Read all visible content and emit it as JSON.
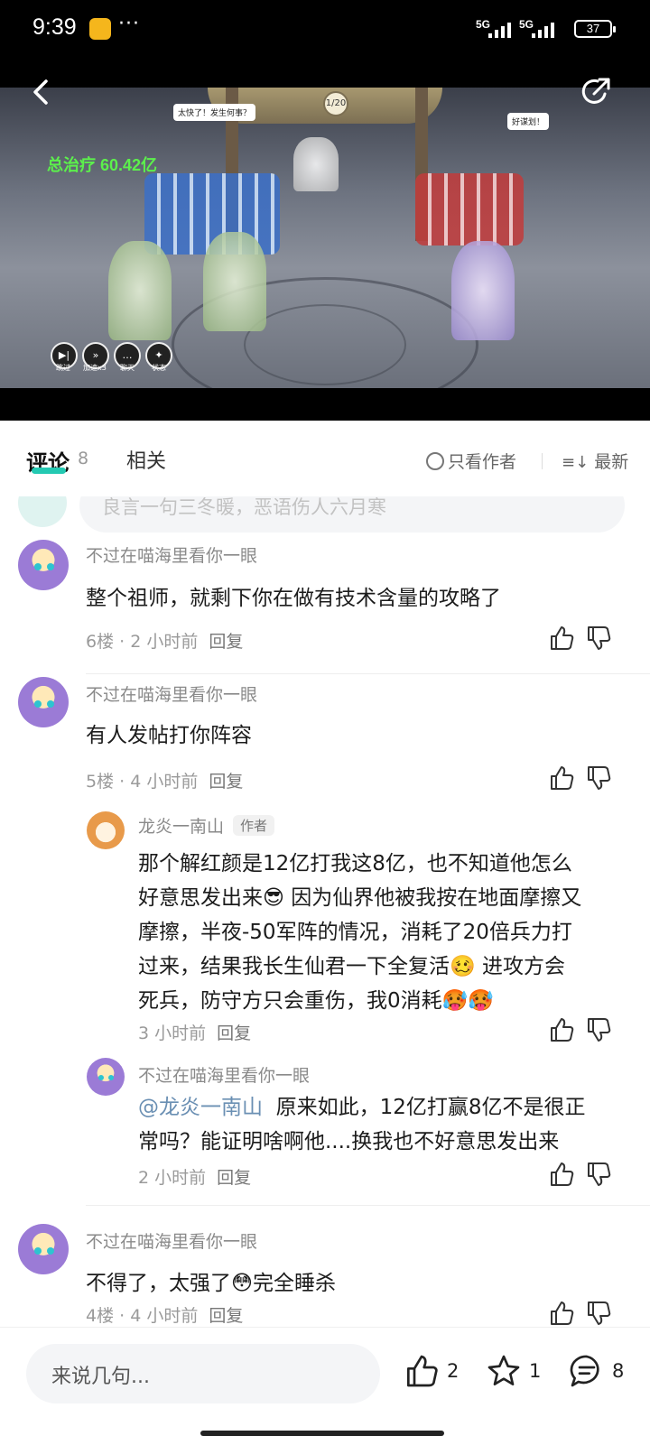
{
  "status_bar": {
    "time": "9:39",
    "dots": "···",
    "signal1": "5G",
    "signal2": "5G",
    "battery": "37"
  },
  "video": {
    "score_text": "总治疗 60.42亿",
    "round_text": "1/20",
    "bubble_left": "太快了！发生何事？",
    "bubble_right": "好谋划！",
    "controls": [
      "跳过",
      "加速x3",
      "聊天",
      "状态"
    ]
  },
  "tabs": {
    "comments_label": "评论",
    "comments_count": "8",
    "related_label": "相关",
    "only_author": "只看作者",
    "latest": "最新"
  },
  "comment_prompt": {
    "placeholder": "良言一句三冬暖，恶语伤人六月寒"
  },
  "comments": [
    {
      "user": "不过在喵海里看你一眼",
      "text": "整个祖师，就剩下你在做有技术含量的攻略了",
      "meta": "6楼 · 2 小时前",
      "reply": "回复"
    },
    {
      "user": "不过在喵海里看你一眼",
      "text": "有人发帖打你阵容",
      "meta": "5楼 · 4 小时前",
      "reply": "回复",
      "replies": [
        {
          "user": "龙炎一南山",
          "badge": "作者",
          "lines": [
            "那个解红颜是12亿打我这8亿，也不知道他怎么",
            "好意思发出来😎 因为仙界他被我按在地面摩擦又",
            "摩擦，半夜-50军阵的情况，消耗了20倍兵力打",
            "过来，结果我长生仙君一下全复活🥴 进攻方会",
            "死兵，防守方只会重伤，我0消耗🥵🥵"
          ],
          "meta": "3 小时前",
          "reply": "回复"
        },
        {
          "user": "不过在喵海里看你一眼",
          "mention": "@龙炎一南山",
          "lines": [
            "原来如此，12亿打赢8亿不是很正",
            "常吗？能证明啥啊他....换我也不好意思发出来"
          ],
          "meta": "2 小时前",
          "reply": "回复"
        }
      ]
    },
    {
      "user": "不过在喵海里看你一眼",
      "text": "不得了，太强了😳完全睡杀",
      "meta": "4楼 · 4 小时前",
      "reply": "回复"
    }
  ],
  "bottom_bar": {
    "input_placeholder": "来说几句...",
    "likes": "2",
    "stars": "1",
    "comments": "8"
  },
  "colors": {
    "accent": "#23c9b2",
    "muted_text": "#9a9a9a"
  }
}
